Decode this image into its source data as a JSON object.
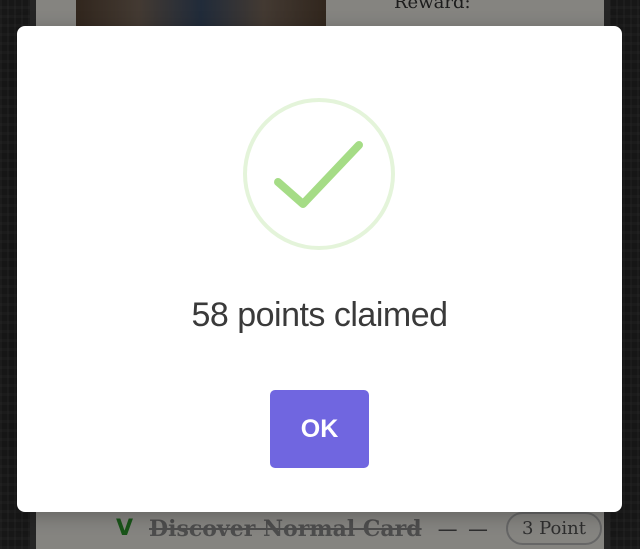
{
  "background": {
    "reward_label": "Reward:",
    "reward_value": "",
    "task": {
      "check_mark": "V",
      "name": "Discover Normal Card",
      "dash": "— —",
      "points": "3 Point"
    }
  },
  "modal": {
    "icon": "checkmark-circle-icon",
    "title": "58 points claimed",
    "ok_label": "OK"
  },
  "colors": {
    "accent": "#7066e0",
    "success": "#a5dc86",
    "success_ring": "rgba(165,220,134,0.3)"
  }
}
